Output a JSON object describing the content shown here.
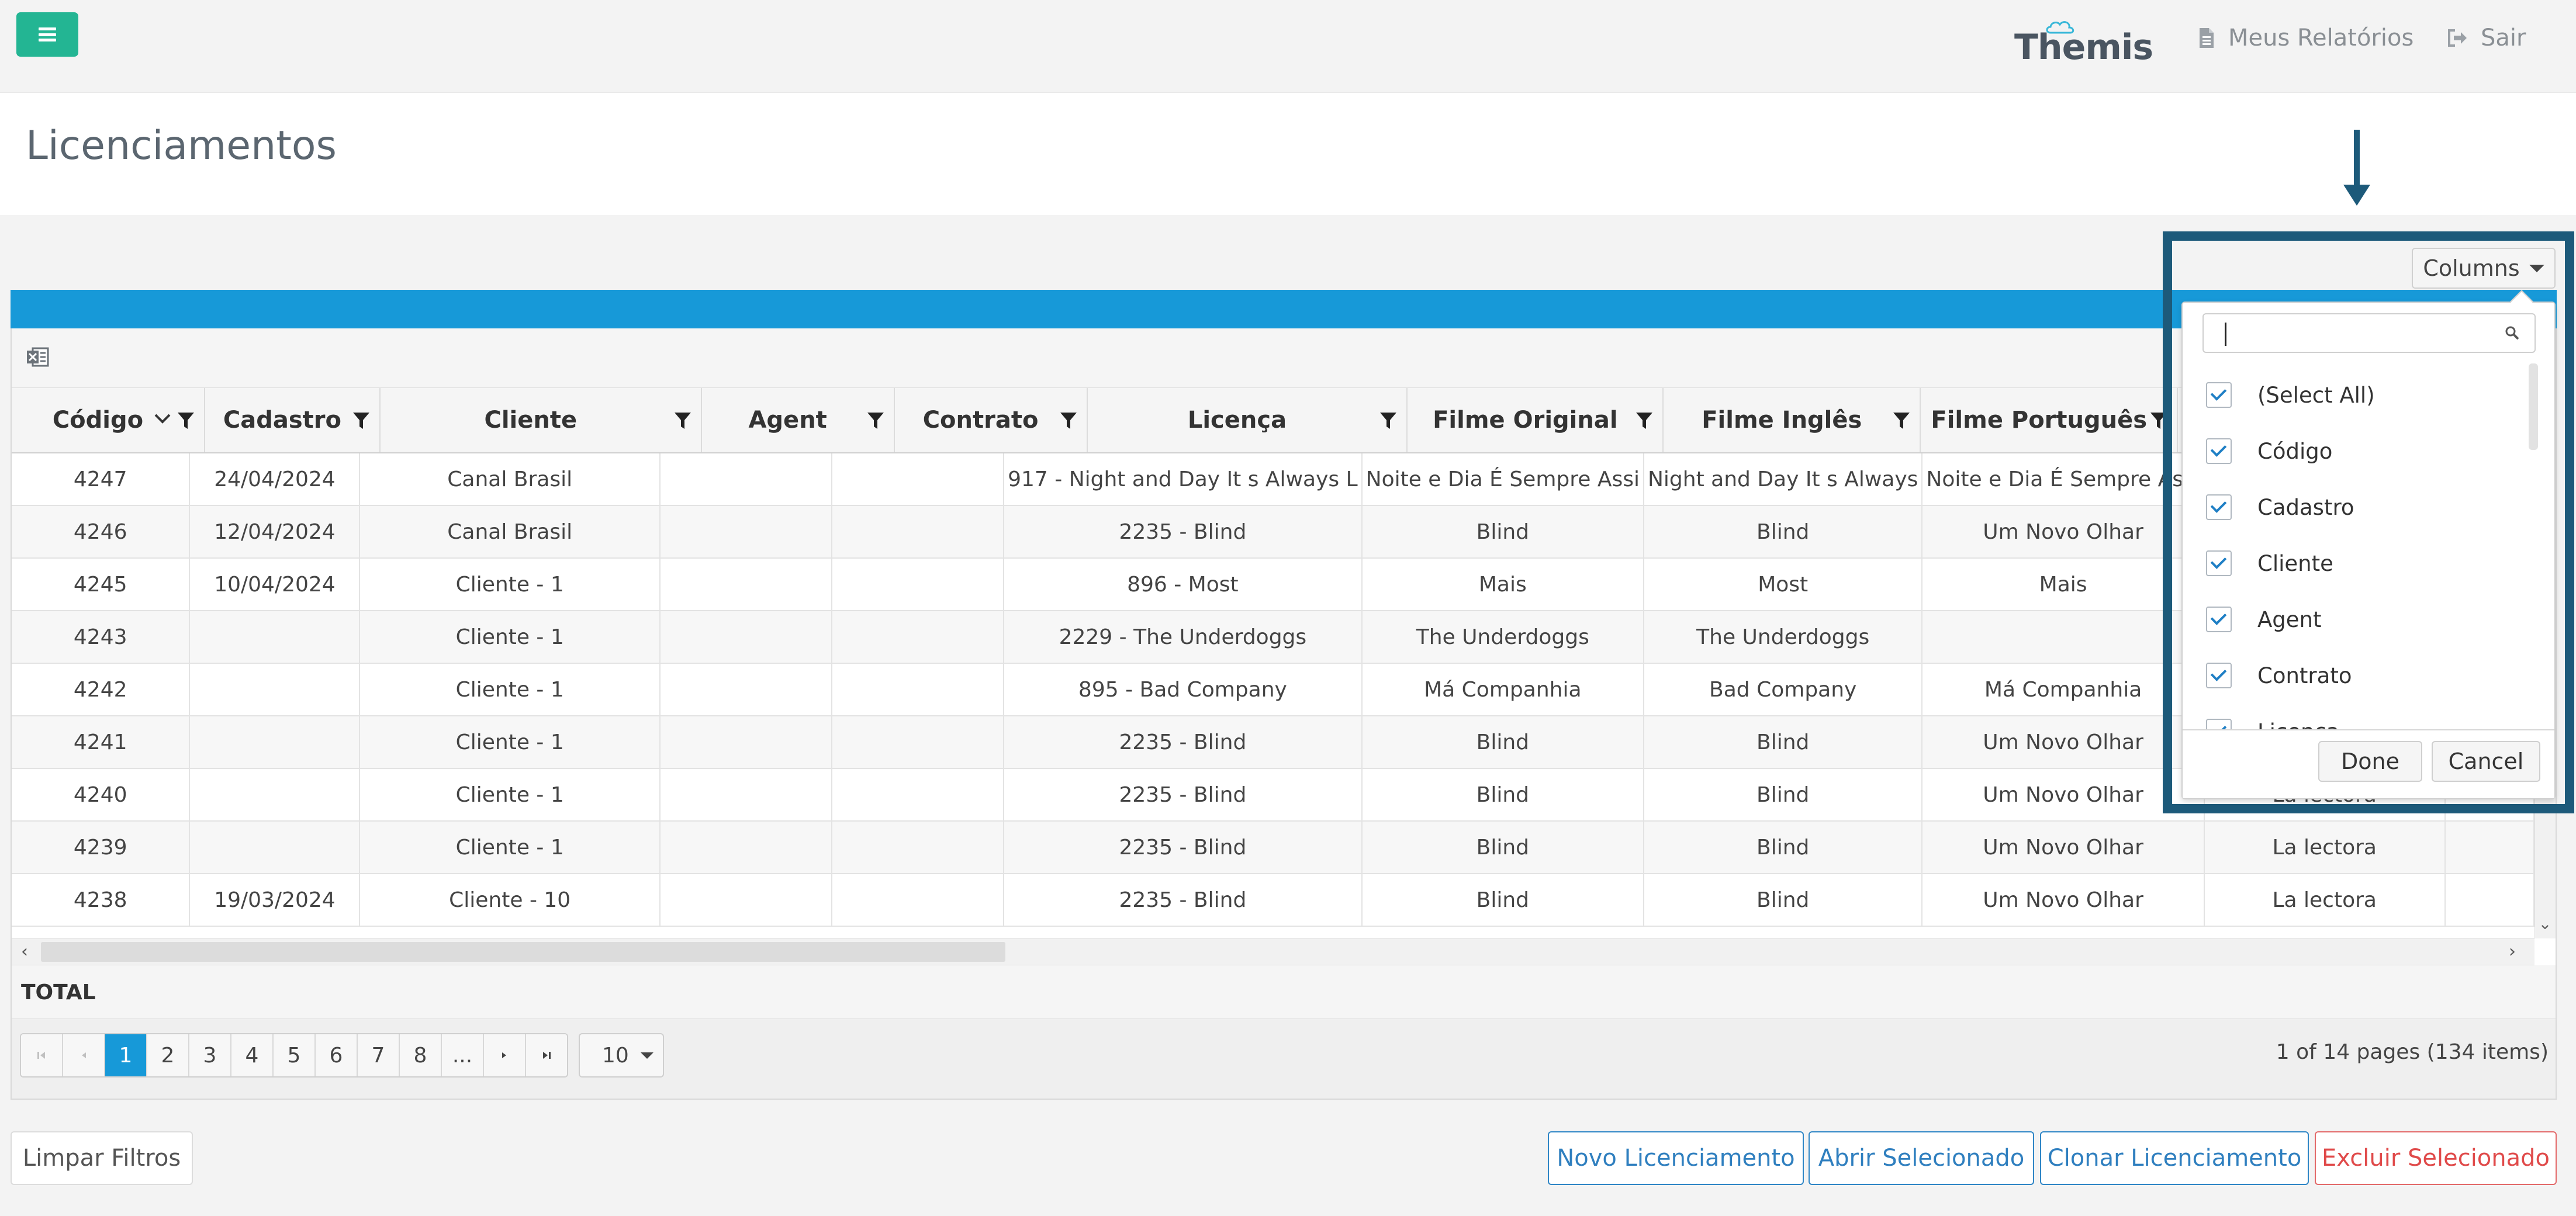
{
  "topbar": {
    "logo_text": "Themis",
    "reports_label": "Meus Relatórios",
    "logout_label": "Sair"
  },
  "page": {
    "title": "Licenciamentos"
  },
  "grid": {
    "columns": [
      "Código",
      "Cadastro",
      "Cliente",
      "Agent",
      "Contrato",
      "Licença",
      "Filme Original",
      "Filme Inglês",
      "Filme Português",
      "",
      ""
    ],
    "rows": [
      [
        "4247",
        "24/04/2024",
        "Canal Brasil",
        "",
        "",
        "917 - Night and Day It s Always L",
        "Noite e Dia É Sempre Assi",
        "Night and Day It s Always",
        "Noite e Dia É Sempre Assi",
        "",
        ""
      ],
      [
        "4246",
        "12/04/2024",
        "Canal Brasil",
        "",
        "",
        "2235 - Blind",
        "Blind",
        "Blind",
        "Um Novo Olhar",
        "",
        ""
      ],
      [
        "4245",
        "10/04/2024",
        "Cliente - 1",
        "",
        "",
        "896 - Most",
        "Mais",
        "Most",
        "Mais",
        "",
        ""
      ],
      [
        "4243",
        "",
        "Cliente - 1",
        "",
        "",
        "2229 - The Underdoggs",
        "The Underdoggs",
        "The Underdoggs",
        "",
        "",
        ""
      ],
      [
        "4242",
        "",
        "Cliente - 1",
        "",
        "",
        "895 - Bad Company",
        "Má Companhia",
        "Bad Company",
        "Má Companhia",
        "",
        ""
      ],
      [
        "4241",
        "",
        "Cliente - 1",
        "",
        "",
        "2235 - Blind",
        "Blind",
        "Blind",
        "Um Novo Olhar",
        "",
        ""
      ],
      [
        "4240",
        "",
        "Cliente - 1",
        "",
        "",
        "2235 - Blind",
        "Blind",
        "Blind",
        "Um Novo Olhar",
        "La lectora",
        ""
      ],
      [
        "4239",
        "",
        "Cliente - 1",
        "",
        "",
        "2235 - Blind",
        "Blind",
        "Blind",
        "Um Novo Olhar",
        "La lectora",
        ""
      ],
      [
        "4238",
        "19/03/2024",
        "Cliente - 10",
        "",
        "",
        "2235 - Blind",
        "Blind",
        "Blind",
        "Um Novo Olhar",
        "La lectora",
        ""
      ]
    ],
    "total_label": "TOTAL"
  },
  "pager": {
    "pages": [
      "1",
      "2",
      "3",
      "4",
      "5",
      "6",
      "7",
      "8",
      "..."
    ],
    "current": "1",
    "page_size": "10",
    "info": "1 of 14 pages (134 items)"
  },
  "column_chooser": {
    "button_label": "Columns",
    "search_value": "",
    "items": [
      "(Select All)",
      "Código",
      "Cadastro",
      "Cliente",
      "Agent",
      "Contrato",
      "Licença"
    ],
    "done_label": "Done",
    "cancel_label": "Cancel"
  },
  "actions": {
    "clear_filters": "Limpar Filtros",
    "new": "Novo Licenciamento",
    "open": "Abrir Selecionado",
    "clone": "Clonar Licenciamento",
    "delete": "Excluir Selecionado"
  },
  "colors": {
    "menu_green": "#23b593",
    "grid_blue": "#1799d8",
    "highlight_navy": "#1d5a7a",
    "danger_red": "#e04a4a"
  }
}
